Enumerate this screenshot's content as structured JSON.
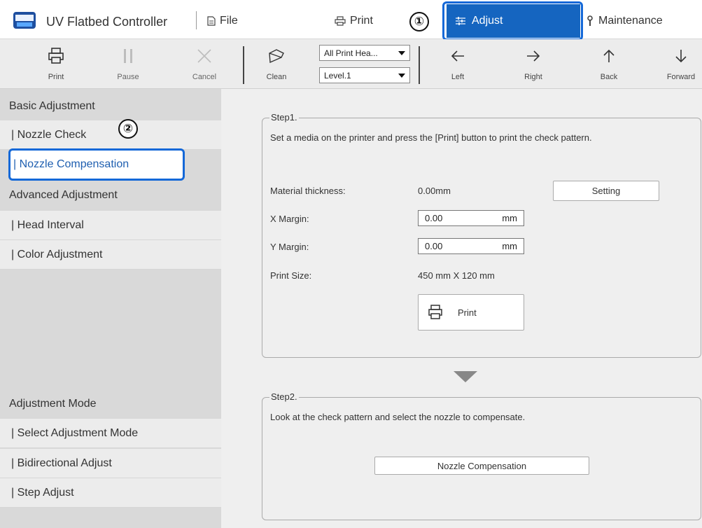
{
  "app": {
    "title": "UV Flatbed Controller"
  },
  "menu": {
    "file": "File",
    "print": "Print",
    "adjust": "Adjust",
    "maintenance": "Maintenance"
  },
  "callouts": {
    "one": "①",
    "two": "②"
  },
  "toolbar": {
    "print": "Print",
    "pause": "Pause",
    "cancel": "Cancel",
    "clean": "Clean",
    "head_select": "All Print Hea...",
    "level_select": "Level.1",
    "left": "Left",
    "right": "Right",
    "back": "Back",
    "forward": "Forward"
  },
  "sidebar": {
    "basic_header": "Basic Adjustment",
    "nozzle_check": "| Nozzle Check",
    "nozzle_compensation": "| Nozzle Compensation",
    "advanced_header": "Advanced Adjustment",
    "head_interval": "| Head Interval",
    "color_adjustment": "| Color Adjustment",
    "mode_header": "Adjustment Mode",
    "select_mode": "| Select Adjustment Mode",
    "bidirectional": "| Bidirectional Adjust",
    "step_adjust": "| Step Adjust"
  },
  "step1": {
    "legend": "Step1.",
    "description": "Set a media on the printer and press the [Print] button to print the check pattern.",
    "material_label": "Material thickness:",
    "material_value": "0.00mm",
    "setting_button": "Setting",
    "x_margin_label": "X Margin:",
    "x_margin_value": "0.00",
    "y_margin_label": "Y Margin:",
    "y_margin_value": "0.00",
    "unit": "mm",
    "print_size_label": "Print Size:",
    "print_size_value": "450 mm X 120 mm",
    "print_button": "Print"
  },
  "step2": {
    "legend": "Step2.",
    "description": "Look at the check pattern and select the nozzle to compensate.",
    "button": "Nozzle Compensation"
  },
  "colors": {
    "accent": "#1565c0",
    "callout": "#1468d8",
    "sidebar_bg": "#d9d9d9",
    "panel_bg": "#efefef"
  }
}
